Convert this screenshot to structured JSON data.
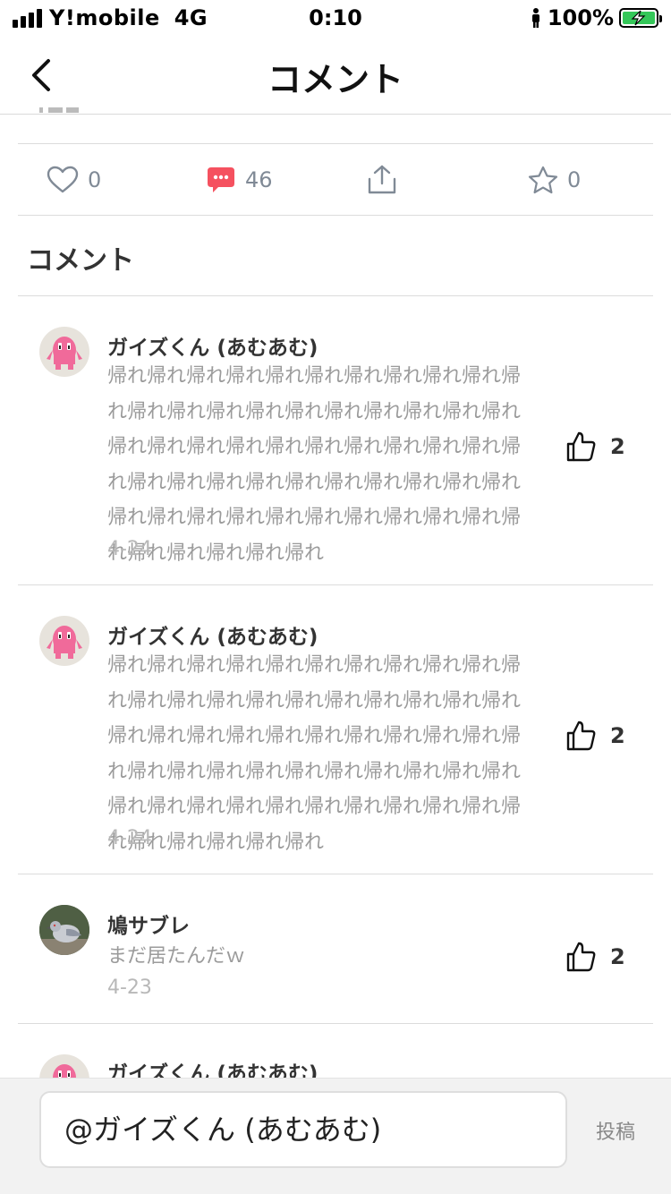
{
  "status_bar": {
    "carrier": "Y!mobile",
    "network": "4G",
    "time": "0:10",
    "battery": "100%"
  },
  "nav": {
    "title": "コメント"
  },
  "actions": {
    "like_count": "0",
    "comment_count": "46",
    "favorite_count": "0",
    "comment_color": "#f5515f"
  },
  "section": {
    "title": "コメント"
  },
  "comments": [
    {
      "name": "ガイズくん (あむあむ)",
      "body": "帰れ帰れ帰れ帰れ帰れ帰れ帰れ帰れ帰れ帰れ帰れ帰れ帰れ帰れ帰れ帰れ帰れ帰れ帰れ帰れ帰れ帰れ帰れ帰れ帰れ帰れ帰れ帰れ帰れ帰れ帰れ帰れ帰れ帰れ帰れ帰れ帰れ帰れ帰れ帰れ帰れ帰れ帰れ帰れ帰れ帰れ帰れ帰れ帰れ帰れ帰れ帰れ帰れ帰れ帰れ帰れ帰れ帰れ",
      "date": "4-24",
      "likes": "2",
      "avatar_icon": "pink-monster-avatar"
    },
    {
      "name": "ガイズくん (あむあむ)",
      "body": "帰れ帰れ帰れ帰れ帰れ帰れ帰れ帰れ帰れ帰れ帰れ帰れ帰れ帰れ帰れ帰れ帰れ帰れ帰れ帰れ帰れ帰れ帰れ帰れ帰れ帰れ帰れ帰れ帰れ帰れ帰れ帰れ帰れ帰れ帰れ帰れ帰れ帰れ帰れ帰れ帰れ帰れ帰れ帰れ帰れ帰れ帰れ帰れ帰れ帰れ帰れ帰れ帰れ帰れ帰れ帰れ帰れ帰れ",
      "date": "4-24",
      "likes": "2",
      "avatar_icon": "pink-monster-avatar"
    },
    {
      "name": "鳩サブレ",
      "body": "まだ居たんだｗ",
      "date": "4-23",
      "likes": "2",
      "avatar_icon": "pigeon-avatar"
    },
    {
      "name": "ガイズくん (あむあむ)",
      "avatar_icon": "pink-monster-avatar"
    }
  ],
  "composer": {
    "value": "@ガイズくん (あむあむ)",
    "submit_label": "投稿"
  }
}
